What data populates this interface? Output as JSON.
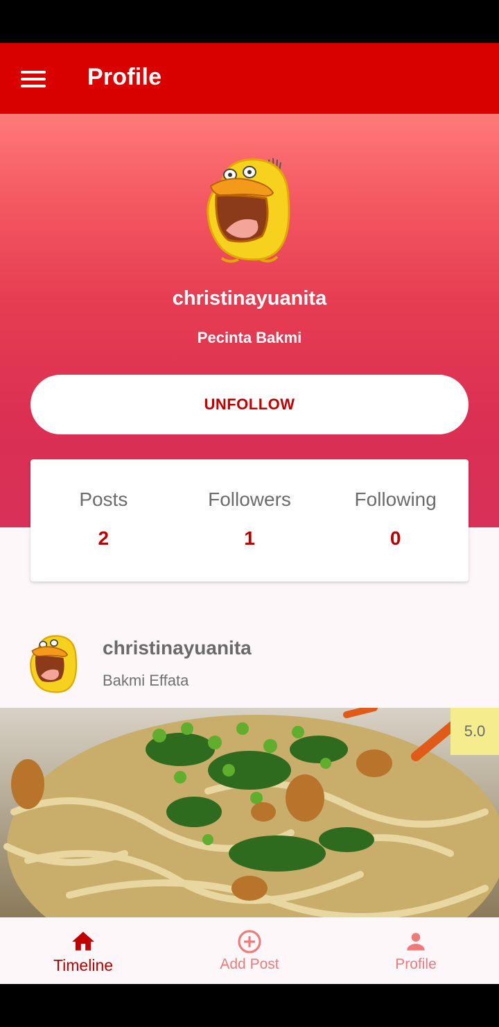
{
  "app_bar": {
    "title": "Profile"
  },
  "profile": {
    "username": "christinayuanita",
    "bio": "Pecinta Bakmi",
    "action_label": "UNFOLLOW"
  },
  "stats": [
    {
      "label": "Posts",
      "value": "2"
    },
    {
      "label": "Followers",
      "value": "1"
    },
    {
      "label": "Following",
      "value": "0"
    }
  ],
  "post": {
    "author": "christinayuanita",
    "place": "Bakmi Effata",
    "rating": "5.0"
  },
  "bottom_nav": [
    {
      "label": "Timeline",
      "icon": "home-icon",
      "active": true
    },
    {
      "label": "Add Post",
      "icon": "add-circle-icon",
      "active": false
    },
    {
      "label": "Profile",
      "icon": "person-icon",
      "active": false
    }
  ],
  "colors": {
    "primary": "#d90000",
    "accent_text": "#b80000",
    "inactive_nav": "#f07a7a",
    "rating_badge": "#f5ec8e"
  }
}
